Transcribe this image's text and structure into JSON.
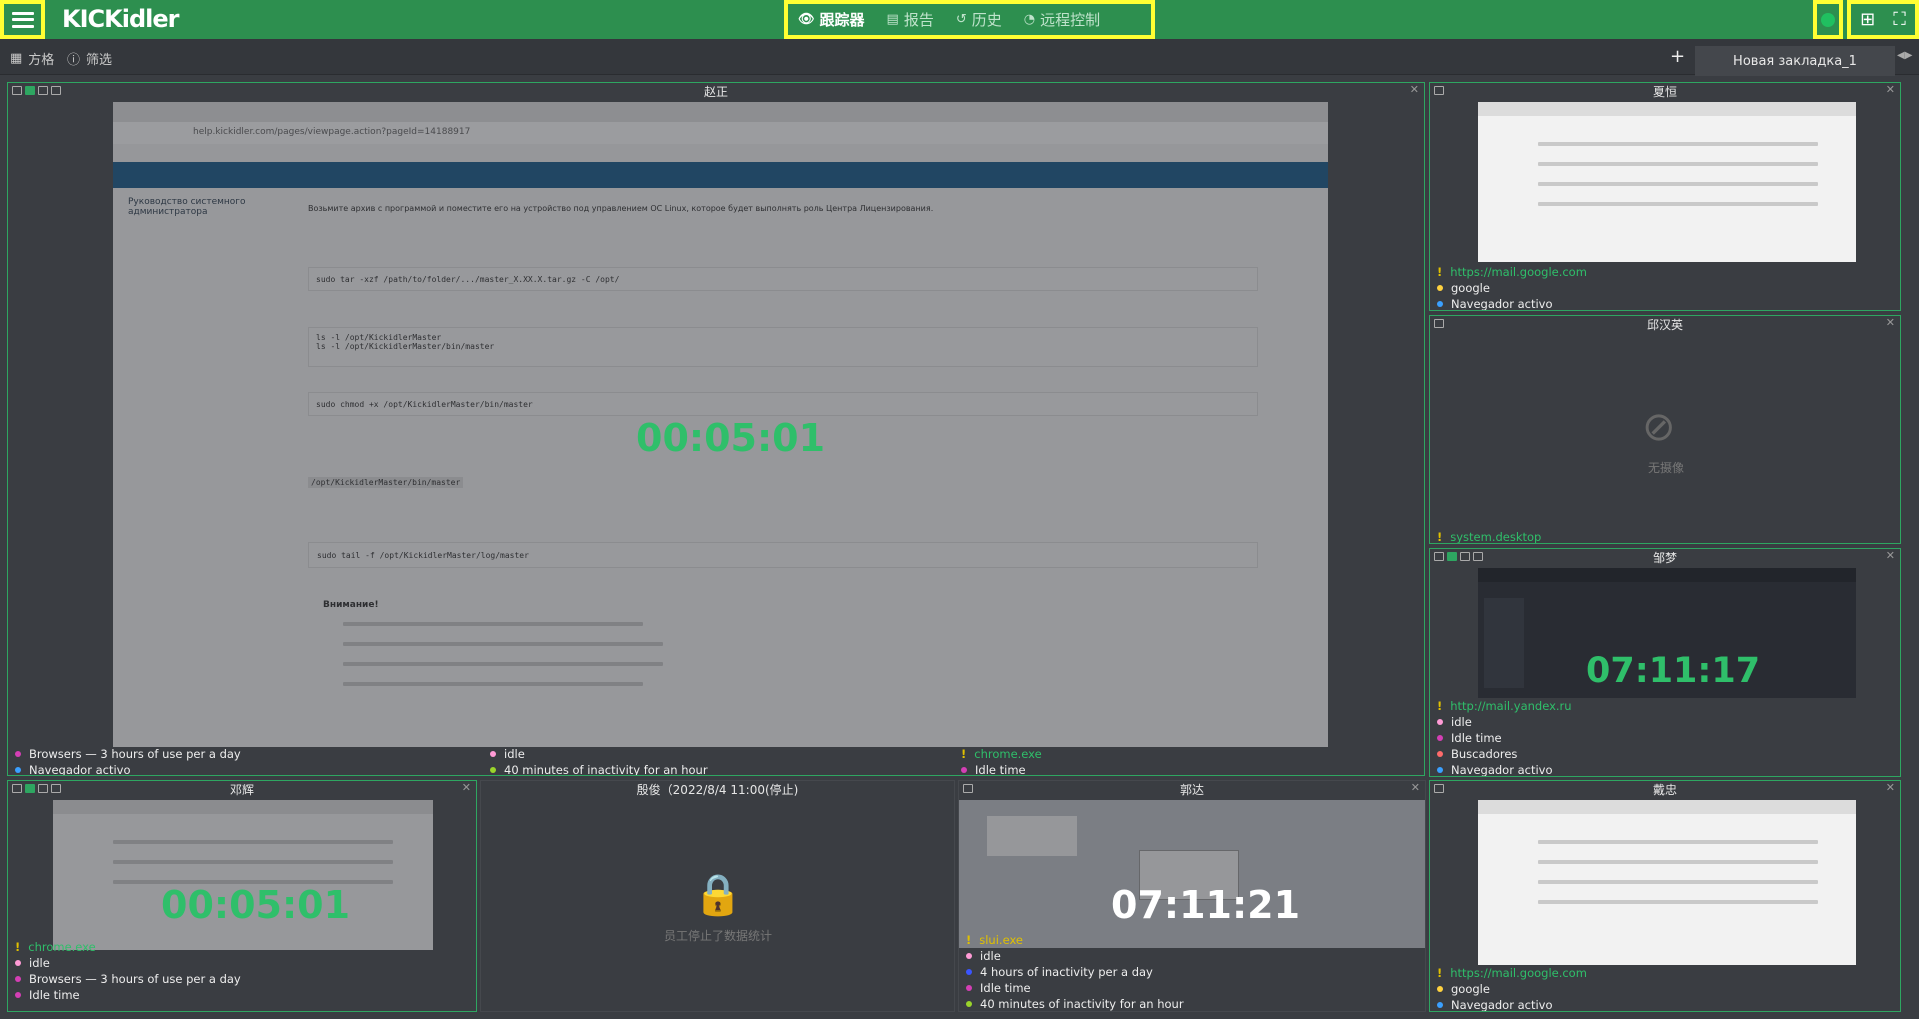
{
  "app": {
    "logo": "KICKidler"
  },
  "nav": {
    "tracker": "跟踪器",
    "report": "报告",
    "history": "历史",
    "remote": "远程控制"
  },
  "toolbar": {
    "grid_label": "方格",
    "filter_label": "筛选",
    "tab_label": "Новая закладка_1"
  },
  "panels": {
    "main": {
      "title": "赵正",
      "timer": "00:05:01",
      "items": [
        {
          "text": "Browsers — 3 hours of use per a day",
          "color": "#d43fb5"
        },
        {
          "text": "Navegador activo",
          "color": "#3aa0ff"
        }
      ],
      "items2": [
        {
          "text": "idle",
          "color": "#ff9bd6"
        },
        {
          "text": "40 minutes of inactivity for an hour",
          "color": "#9ad42b"
        }
      ],
      "items3_app": "chrome.exe",
      "items3": [
        {
          "text": "Idle time",
          "color": "#d43fb5"
        }
      ],
      "doc": {
        "url": "help.kickidler.com/pages/viewpage.action?pageId=14188917",
        "heading": "Руководство системного администратора",
        "line1": "Возьмите архив с программой и поместите его на устройство под управлением ОС Linux, которое будет выполнять роль Центра Лицензирования.",
        "cmd1": "sudo tar -xzf /path/to/folder/.../master_X.XX.X.tar.gz -C /opt/",
        "cmd2": "ls -l /opt/KickidlerMaster",
        "cmd3": "ls -l /opt/KickidlerMaster/bin/master",
        "cmd4": "sudo chmod +x /opt/KickidlerMaster/bin/master",
        "cmd5": "/opt/KickidlerMaster/bin/master",
        "cmd6": "sudo tail -f /opt/KickidlerMaster/log/master",
        "warn": "Внимание!"
      }
    },
    "p2": {
      "title": "夏恒",
      "url": "https://mail.google.com",
      "items": [
        {
          "text": "google",
          "color": "#ffd23f"
        },
        {
          "text": "Navegador activo",
          "color": "#3aa0ff"
        }
      ]
    },
    "p3": {
      "title": "邱汉英",
      "nocam": "无摄像",
      "url": "system.desktop"
    },
    "p4": {
      "title": "邹梦",
      "timer": "07:11:17",
      "url": "http://mail.yandex.ru",
      "items": [
        {
          "text": "idle",
          "color": "#ff9bd6"
        },
        {
          "text": "Idle time",
          "color": "#d43fb5"
        },
        {
          "text": "Buscadores",
          "color": "#ff6b6b"
        },
        {
          "text": "Navegador activo",
          "color": "#3aa0ff"
        }
      ]
    },
    "p5": {
      "title": "邓辉",
      "timer": "00:05:01",
      "url": "chrome.exe",
      "items": [
        {
          "text": "idle",
          "color": "#ff9bd6"
        },
        {
          "text": "Browsers — 3 hours of use per a day",
          "color": "#d43fb5"
        },
        {
          "text": "Idle time",
          "color": "#d43fb5"
        }
      ]
    },
    "p6": {
      "title": "殷俊（2022/8/4 11:00(停止)",
      "msg": "员工停止了数据统计"
    },
    "p7": {
      "title": "郭达",
      "timer": "07:11:21",
      "app": "slui.exe",
      "items": [
        {
          "text": "idle",
          "color": "#ff9bd6"
        },
        {
          "text": "4 hours of inactivity per a day",
          "color": "#3a55ff"
        },
        {
          "text": "Idle time",
          "color": "#d43fb5"
        },
        {
          "text": "40 minutes of inactivity for an hour",
          "color": "#9ad42b"
        }
      ]
    },
    "p8": {
      "title": "戴忠",
      "url": "https://mail.google.com",
      "items": [
        {
          "text": "google",
          "color": "#ffd23f"
        },
        {
          "text": "Navegador activo",
          "color": "#3aa0ff"
        }
      ]
    }
  }
}
